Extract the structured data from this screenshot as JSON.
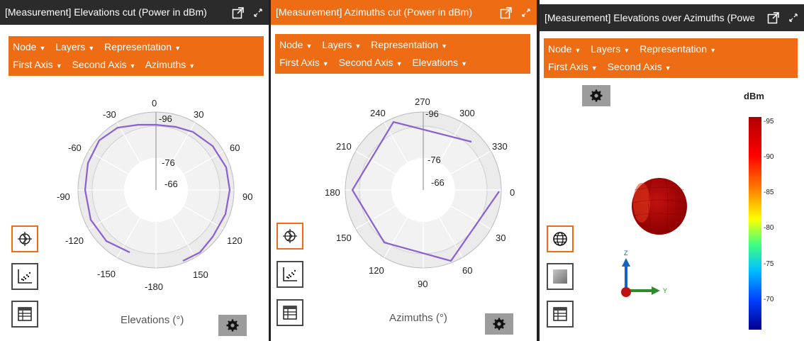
{
  "panels": [
    {
      "title": "[Measurement] Elevations cut (Power in dBm)",
      "title_bg": "#2b2b2b",
      "menu_row1": [
        "Node",
        "Layers",
        "Representation"
      ],
      "menu_row2": [
        "First Axis",
        "Second Axis",
        "Azimuths"
      ],
      "axis_title": "Elevations (°)",
      "angle_labels": [
        "0",
        "30",
        "60",
        "90",
        "120",
        "150",
        "-180",
        "-150",
        "-120",
        "-90",
        "-60",
        "-30"
      ],
      "radial_labels": [
        "-96",
        "-76",
        "-66"
      ]
    },
    {
      "title": "[Measurement] Azimuths cut (Power in dBm)",
      "title_bg": "#ed6c14",
      "menu_row1": [
        "Node",
        "Layers",
        "Representation"
      ],
      "menu_row2": [
        "First Axis",
        "Second Axis",
        "Elevations"
      ],
      "axis_title": "Azimuths (°)",
      "angle_labels": [
        "270",
        "300",
        "330",
        "0",
        "30",
        "60",
        "90",
        "120",
        "150",
        "180",
        "210",
        "240"
      ],
      "radial_labels": [
        "-96",
        "-76",
        "-66"
      ]
    },
    {
      "title": "[Measurement] Elevations over Azimuths (Power in dBm)",
      "title_bg": "#2b2b2b",
      "menu_row1": [
        "Node",
        "Layers",
        "Representation"
      ],
      "menu_row2": [
        "First Axis",
        "Second Axis"
      ],
      "colorbar_title": "dBm",
      "colorbar_ticks": [
        "-95",
        "-90",
        "-85",
        "-80",
        "-75",
        "-70"
      ],
      "axis_z": "Z",
      "axis_y": "Y"
    }
  ],
  "colors": {
    "accent": "#ed6c14",
    "dark": "#2b2b2b",
    "trace": "#8a5fd0",
    "sphere": "#b80000"
  }
}
